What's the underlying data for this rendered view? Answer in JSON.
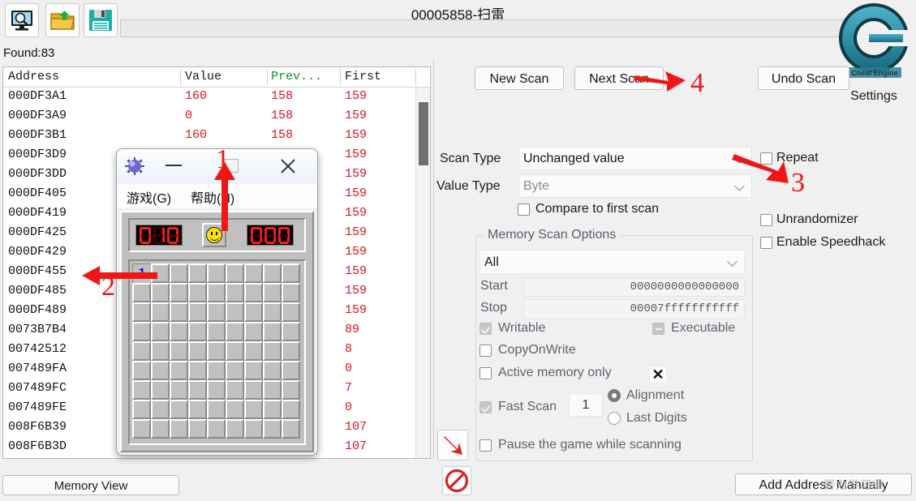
{
  "window": {
    "title": "00005858-扫雷",
    "address_bar_value": ""
  },
  "toolbar": {
    "icons": [
      {
        "name": "open-process-icon",
        "label": "Open Process"
      },
      {
        "name": "open-file-icon",
        "label": "Open"
      },
      {
        "name": "save-file-icon",
        "label": "Save"
      }
    ]
  },
  "branding": {
    "logo_text": "Cheat Engine",
    "settings_label": "Settings",
    "logo_color": "#2d7f96"
  },
  "results": {
    "found_label": "Found:83",
    "columns": [
      "Address",
      "Value",
      "Prev...",
      "First"
    ],
    "column_colors": {
      "prev": "#1a8f2a",
      "value_text": "#dd1122"
    },
    "rows": [
      {
        "address": "000DF3A1",
        "value": "160",
        "prev": "158",
        "first": "159"
      },
      {
        "address": "000DF3A9",
        "value": "0",
        "prev": "158",
        "first": "159"
      },
      {
        "address": "000DF3B1",
        "value": "160",
        "prev": "158",
        "first": "159"
      },
      {
        "address": "000DF3D9",
        "value": "",
        "prev": "",
        "first": "159"
      },
      {
        "address": "000DF3DD",
        "value": "",
        "prev": "",
        "first": "159"
      },
      {
        "address": "000DF405",
        "value": "",
        "prev": "",
        "first": "159"
      },
      {
        "address": "000DF419",
        "value": "",
        "prev": "",
        "first": "159"
      },
      {
        "address": "000DF425",
        "value": "",
        "prev": "",
        "first": "159"
      },
      {
        "address": "000DF429",
        "value": "",
        "prev": "",
        "first": "159"
      },
      {
        "address": "000DF455",
        "value": "",
        "prev": "",
        "first": "159"
      },
      {
        "address": "000DF485",
        "value": "",
        "prev": "",
        "first": "159"
      },
      {
        "address": "000DF489",
        "value": "",
        "prev": "",
        "first": "159"
      },
      {
        "address": "0073B7B4",
        "value": "",
        "prev": "",
        "first": "89"
      },
      {
        "address": "00742512",
        "value": "",
        "prev": "",
        "first": "8"
      },
      {
        "address": "007489FA",
        "value": "",
        "prev": "",
        "first": "0"
      },
      {
        "address": "007489FC",
        "value": "",
        "prev": "",
        "first": "7"
      },
      {
        "address": "007489FE",
        "value": "",
        "prev": "",
        "first": "0"
      },
      {
        "address": "008F6B39",
        "value": "",
        "prev": "",
        "first": "107"
      },
      {
        "address": "008F6B3D",
        "value": "",
        "prev": "",
        "first": "107"
      }
    ]
  },
  "scan": {
    "new_scan": "New Scan",
    "next_scan": "Next Scan",
    "undo_scan": "Undo Scan",
    "scan_type_label": "Scan Type",
    "scan_type_value": "Unchanged value",
    "value_type_label": "Value Type",
    "value_type_value": "Byte",
    "compare_first_scan": "Compare to first scan",
    "repeat": "Repeat",
    "unrandomizer": "Unrandomizer",
    "enable_speedhack": "Enable Speedhack"
  },
  "memory_scan_options": {
    "group_title": "Memory Scan Options",
    "region_value": "All",
    "start_label": "Start",
    "start_value": "0000000000000000",
    "stop_label": "Stop",
    "stop_value": "00007fffffffffff",
    "writable": "Writable",
    "executable": "Executable",
    "copyonwrite": "CopyOnWrite",
    "active_memory_only": "Active memory only",
    "fast_scan": "Fast Scan",
    "fast_scan_value": "1",
    "alignment": "Alignment",
    "last_digits": "Last Digits",
    "pause_game": "Pause the game while scanning"
  },
  "footer": {
    "memory_view": "Memory View",
    "add_address_manually": "Add Address Manually",
    "watermark": "努力学习中"
  },
  "minesweeper": {
    "menu": [
      {
        "name": "menu-game",
        "label": "游戏(G)"
      },
      {
        "name": "menu-help",
        "label": "帮助(H)"
      }
    ],
    "mine_counter": "010",
    "timer": "000",
    "smiley": "smiley-face",
    "grid_cols": 9,
    "grid_rows": 9,
    "revealed_cell": {
      "row": 0,
      "col": 0,
      "text": "1",
      "color": "#0000ee"
    }
  },
  "annotations": {
    "color": "#f01616",
    "markers": [
      {
        "name": "annotation-1",
        "text": "1"
      },
      {
        "name": "annotation-2",
        "text": "2"
      },
      {
        "name": "annotation-3",
        "text": "3"
      },
      {
        "name": "annotation-4",
        "text": "4"
      }
    ]
  }
}
